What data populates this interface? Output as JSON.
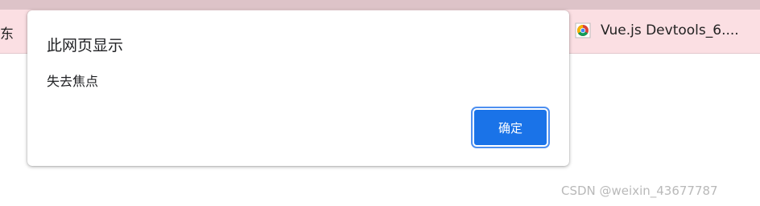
{
  "bookmarks_bar": {
    "left_item_label": "东",
    "right_item": {
      "icon": "chrome-icon",
      "label": "Vue.js Devtools_6...."
    }
  },
  "dialog": {
    "title": "此网页显示",
    "message": "失去焦点",
    "ok_label": "确定"
  },
  "watermark": "CSDN @weixin_43677787",
  "colors": {
    "accent": "#1a73e8",
    "bookmarks_bar_bg": "#fbdfe3",
    "top_strip_bg": "#ddc3c8"
  }
}
